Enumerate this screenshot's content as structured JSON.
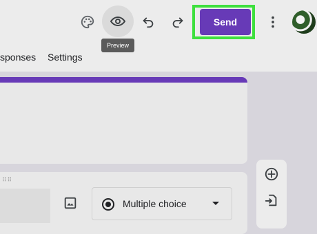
{
  "toolbar": {
    "icons": [
      "palette-icon",
      "eye-icon",
      "undo-icon",
      "redo-icon",
      "more-vert-icon"
    ],
    "preview_tooltip": "Preview",
    "send_label": "Send",
    "highlight_color": "#3ee03e",
    "accent_color": "#673ab7"
  },
  "tabs": [
    {
      "label": "sponses"
    },
    {
      "label": "Settings"
    }
  ],
  "question": {
    "type_label": "Multiple choice"
  },
  "side_toolbar": {
    "icons": [
      "add-question-icon",
      "import-questions-icon"
    ]
  }
}
